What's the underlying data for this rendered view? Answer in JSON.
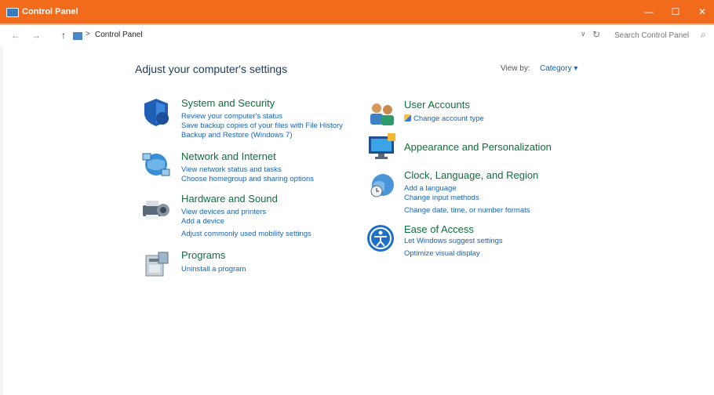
{
  "window": {
    "title": "Control Panel",
    "buttons": {
      "minimize": "—",
      "maximize": "☐",
      "close": "✕"
    }
  },
  "address": {
    "back": "←",
    "forward": "→",
    "up": "↑",
    "separator": ">",
    "crumb": "Control Panel",
    "dropdown": "∨",
    "refresh": "↻",
    "search_placeholder": "Search Control Panel",
    "search_icon": "⌕"
  },
  "main": {
    "heading": "Adjust your computer's settings",
    "view_by_label": "View by:",
    "view_by_value": "Category ▾"
  },
  "categories": {
    "system": {
      "title": "System and Security",
      "links": [
        "Review your computer's status",
        "Save backup copies of your files with File History",
        "Backup and Restore (Windows 7)"
      ]
    },
    "network": {
      "title": "Network and Internet",
      "links": [
        "View network status and tasks",
        "Choose homegroup and sharing options"
      ]
    },
    "hardware": {
      "title": "Hardware and Sound",
      "links": [
        "View devices and printers",
        "Add a device",
        "Adjust commonly used mobility settings"
      ]
    },
    "programs": {
      "title": "Programs",
      "links": [
        "Uninstall a program"
      ]
    },
    "users": {
      "title": "User Accounts",
      "links": [
        "Change account type"
      ]
    },
    "appearance": {
      "title": "Appearance and Personalization",
      "links": []
    },
    "clock": {
      "title": "Clock, Language, and Region",
      "links": [
        "Add a language",
        "Change input methods",
        "Change date, time, or number formats"
      ]
    },
    "ease": {
      "title": "Ease of Access",
      "links": [
        "Let Windows suggest settings",
        "Optimize visual display"
      ]
    }
  }
}
